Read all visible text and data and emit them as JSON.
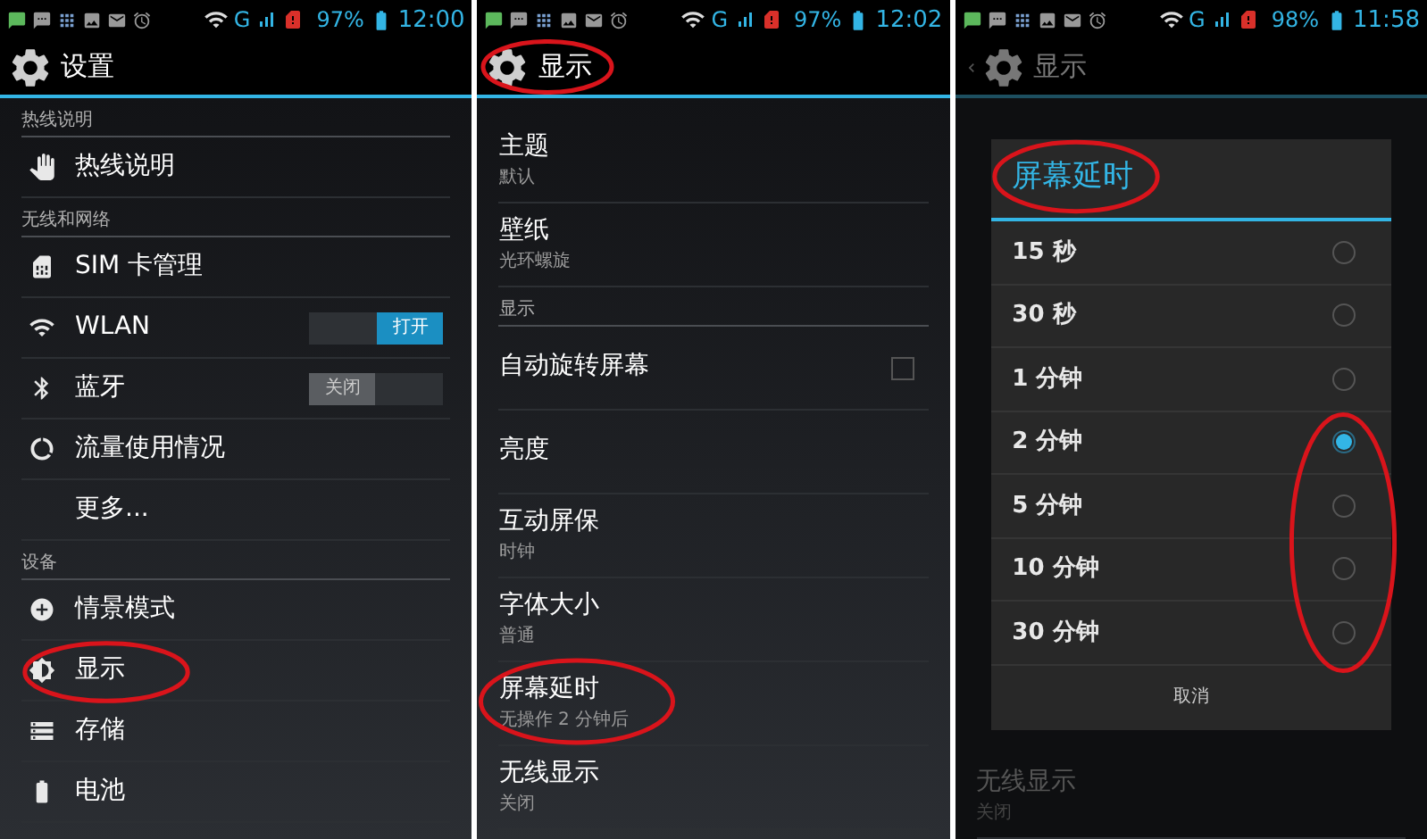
{
  "panels": [
    {
      "status": {
        "network_type": "G",
        "battery_text": "97%",
        "time": "12:00"
      },
      "dimmed": false,
      "back": false,
      "title": "设置",
      "title_circled": false,
      "items": [
        {
          "kind": "header",
          "label": "热线说明"
        },
        {
          "kind": "item",
          "label": "热线说明",
          "circled": false
        },
        {
          "kind": "header",
          "label": "无线和网络"
        },
        {
          "kind": "item",
          "label": "SIM 卡管理",
          "circled": false
        },
        {
          "kind": "toggle",
          "label": "WLAN",
          "on": true,
          "switch_text": "打开"
        },
        {
          "kind": "toggle",
          "label": "蓝牙",
          "on": false,
          "switch_text": "关闭"
        },
        {
          "kind": "item",
          "label": "流量使用情况",
          "circled": false
        },
        {
          "kind": "item",
          "label": "更多...",
          "circled": false
        },
        {
          "kind": "header",
          "label": "设备"
        },
        {
          "kind": "item",
          "label": "情景模式",
          "circled": false
        },
        {
          "kind": "item",
          "label": "显示",
          "circled": true
        },
        {
          "kind": "item",
          "label": "存储",
          "circled": false
        },
        {
          "kind": "item",
          "label": "电池",
          "circled": false
        }
      ]
    },
    {
      "status": {
        "network_type": "G",
        "battery_text": "97%",
        "time": "12:02"
      },
      "dimmed": false,
      "back": false,
      "title": "显示",
      "title_circled": true,
      "items": [
        {
          "kind": "item",
          "label": "主题",
          "sub": "默认",
          "circled": false
        },
        {
          "kind": "item",
          "label": "壁纸",
          "sub": "光环螺旋",
          "circled": false
        },
        {
          "kind": "header",
          "label": "显示"
        },
        {
          "kind": "checkbox",
          "label": "自动旋转屏幕",
          "checked": false
        },
        {
          "kind": "item",
          "label": "亮度",
          "circled": false
        },
        {
          "kind": "item",
          "label": "互动屏保",
          "sub": "时钟",
          "circled": false
        },
        {
          "kind": "item",
          "label": "字体大小",
          "sub": "普通",
          "circled": false
        },
        {
          "kind": "item",
          "label": "屏幕延时",
          "sub": "无操作 2 分钟后",
          "circled": true
        },
        {
          "kind": "item",
          "label": "无线显示",
          "sub": "关闭",
          "circled": false
        }
      ]
    },
    {
      "status": {
        "network_type": "G",
        "battery_text": "98%",
        "time": "11:58"
      },
      "dimmed": true,
      "back": true,
      "title": "显示",
      "title_circled": false,
      "items": [
        {
          "kind": "item",
          "label": "无线显示",
          "sub": "关闭",
          "circled": false
        }
      ],
      "dialog": {
        "title": "屏幕延时",
        "title_circled": true,
        "radios_circled": true,
        "options": [
          {
            "label": "15 秒",
            "selected": false
          },
          {
            "label": "30 秒",
            "selected": false
          },
          {
            "label": "1 分钟",
            "selected": false
          },
          {
            "label": "2 分钟",
            "selected": true
          },
          {
            "label": "5 分钟",
            "selected": false
          },
          {
            "label": "10 分钟",
            "selected": false
          },
          {
            "label": "30 分钟",
            "selected": false
          }
        ],
        "cancel": "取消"
      }
    }
  ]
}
